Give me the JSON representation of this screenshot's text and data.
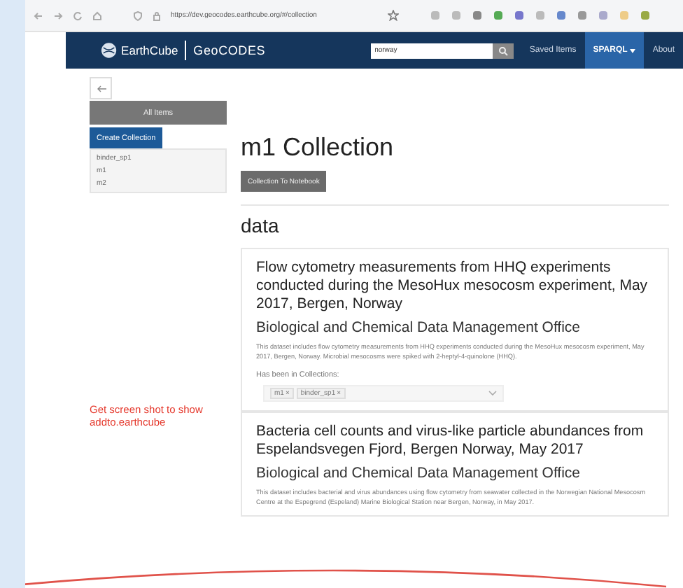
{
  "browser": {
    "url": "https://dev.geocodes.earthcube.org/#/collection"
  },
  "navbar": {
    "brand": "EarthCube",
    "product": "GeoCODES",
    "search": {
      "value": "norway"
    },
    "links": [
      {
        "label": "Saved Items",
        "kind": "link"
      },
      {
        "label": "SPARQL",
        "kind": "dropdown"
      },
      {
        "label": "About",
        "kind": "link"
      }
    ]
  },
  "sidebar": {
    "header": "All Items",
    "create_button": "Create Collection",
    "collections": [
      "binder_sp1",
      "m1",
      "m2"
    ]
  },
  "main": {
    "title": "m1 Collection",
    "notebook_button": "Collection To Notebook",
    "section": "data",
    "results": [
      {
        "title": "Flow cytometry measurements from HHQ experiments conducted during the MesoHux mesocosm experiment, May 2017, Bergen, Norway",
        "publisher": "Biological and Chemical Data Management Office",
        "description": "This dataset includes flow cytometry measurements from HHQ experiments conducted during the MesoHux mesocosm experiment, May 2017, Bergen, Norway. Microbial mesocosms were spiked with 2-heptyl-4-quinolone (HHQ).",
        "collections_label": "Has been in Collections:",
        "tags": [
          {
            "label": "m1",
            "remove": "×"
          },
          {
            "label": "binder_sp1",
            "remove": "×"
          }
        ]
      },
      {
        "title": "Bacteria cell counts and virus-like particle abundances from Espelandsvegen Fjord, Bergen Norway, May 2017",
        "publisher": "Biological and Chemical Data Management Office",
        "description": "This dataset includes bacterial and virus abundances using flow cytometry from seawater collected in the Norwegian National Mesocosm Centre at the Espegrend (Espeland) Marine Biological Station near Bergen, Norway, in May 2017."
      }
    ]
  },
  "annotation": "Get screen shot to show addto.earthcube"
}
